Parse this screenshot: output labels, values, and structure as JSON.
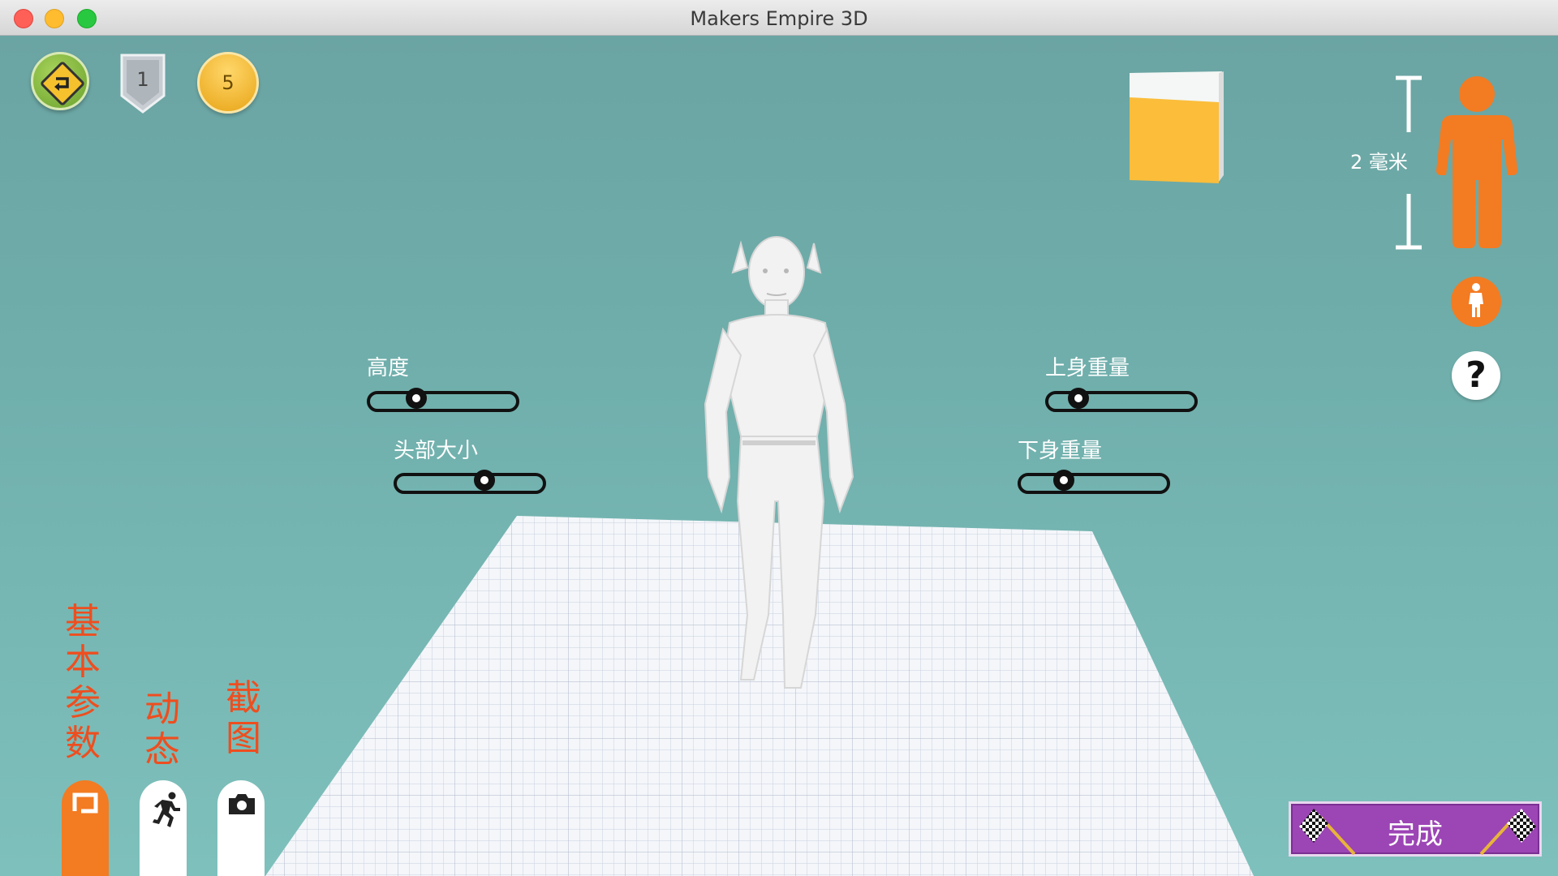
{
  "window": {
    "title": "Makers Empire 3D"
  },
  "badges": {
    "shield_value": "1",
    "coin_value": "5"
  },
  "scale": {
    "label": "2 毫米"
  },
  "sliders": [
    {
      "label": "高度",
      "value": 0.32
    },
    {
      "label": "头部大小",
      "value": 0.6
    },
    {
      "label": "上身重量",
      "value": 0.19
    },
    {
      "label": "下身重量",
      "value": 0.28
    }
  ],
  "tabs": [
    {
      "label": "基本参数",
      "icon": "square-frame-icon",
      "active": true
    },
    {
      "label": "动态",
      "icon": "running-person-icon",
      "active": false
    },
    {
      "label": "截图",
      "icon": "camera-icon",
      "active": false
    }
  ],
  "finish": {
    "label": "完成"
  },
  "colors": {
    "background": "#6faeab",
    "accent": "#f37b22",
    "tab_text": "#ee4e1f",
    "finish": "#9c45b5",
    "cube": "#fbbd3a"
  }
}
